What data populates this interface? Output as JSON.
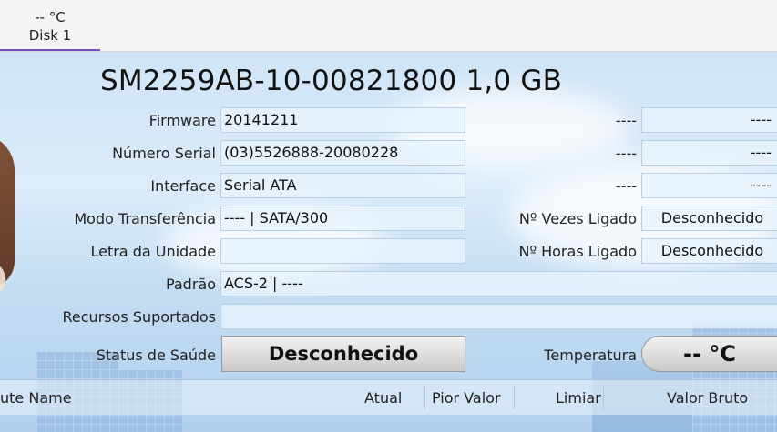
{
  "tabs": [
    {
      "temp": "-- °C",
      "name": "Disk 1"
    }
  ],
  "disk": {
    "title": "SM2259AB-10-00821800 1,0 GB"
  },
  "labels": {
    "firmware": "Firmware",
    "serial": "Número Serial",
    "interface": "Interface",
    "transfer": "Modo Transferência",
    "drive_letter": "Letra da Unidade",
    "standard": "Padrão",
    "features": "Recursos Suportados",
    "health": "Status de Saúde",
    "power_on_count": "Nº Vezes Ligado",
    "power_on_hours": "Nº Horas Ligado",
    "temperature": "Temperatura"
  },
  "values": {
    "firmware": "20141211",
    "serial": "(03)5526888-20080228",
    "interface": "Serial ATA",
    "transfer": "---- | SATA/300",
    "drive_letter": "",
    "standard": "ACS-2 | ----",
    "features": "",
    "health": "Desconhecido",
    "power_on_count": "Desconhecido",
    "power_on_hours": "Desconhecido",
    "temperature": "-- °C"
  },
  "extra_rows": [
    {
      "label": "----",
      "value": "----"
    },
    {
      "label": "----",
      "value": "----"
    },
    {
      "label": "----",
      "value": "----"
    }
  ],
  "table": {
    "columns": [
      "ute Name",
      "Atual",
      "Pior Valor",
      "Limiar",
      "Valor Bruto"
    ]
  }
}
